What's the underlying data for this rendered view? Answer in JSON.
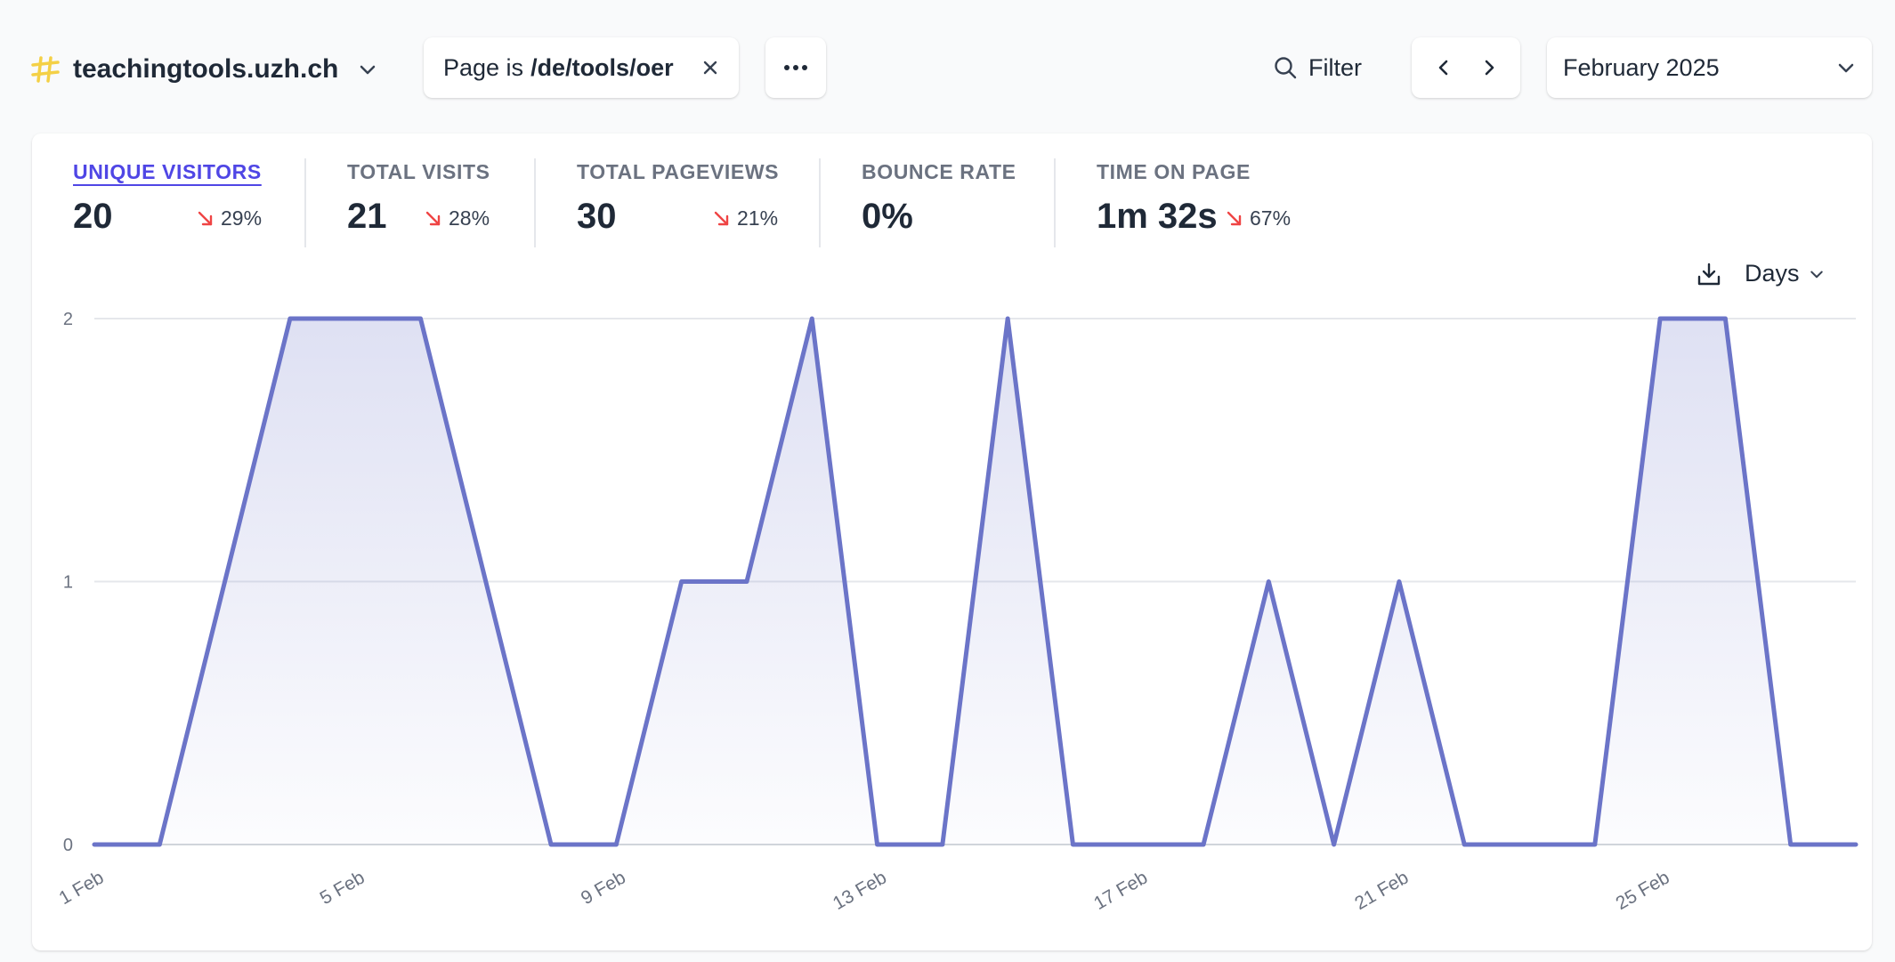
{
  "site": {
    "name": "teachingtools.uzh.ch"
  },
  "filter": {
    "prefix": "Page is",
    "value": "/de/tools/oer"
  },
  "toolbar": {
    "more_label": "···",
    "filter_label": "Filter",
    "period_label": "February 2025"
  },
  "metrics": [
    {
      "label": "UNIQUE VISITORS",
      "value": "20",
      "change": "29%"
    },
    {
      "label": "TOTAL VISITS",
      "value": "21",
      "change": "28%"
    },
    {
      "label": "TOTAL PAGEVIEWS",
      "value": "30",
      "change": "21%"
    },
    {
      "label": "BOUNCE RATE",
      "value": "0%",
      "change": ""
    },
    {
      "label": "TIME ON PAGE",
      "value": "1m 32s",
      "change": "67%"
    }
  ],
  "interval": {
    "label": "Days"
  },
  "icons": {
    "download": "download-icon",
    "chevron": "chevron-down-icon",
    "search": "search-icon",
    "close": "close-icon",
    "prev": "chevron-left-icon",
    "next": "chevron-right-icon"
  },
  "colors": {
    "line": "#6b74c8",
    "active": "#4f46e5",
    "down": "#ef4444",
    "logo": "#f4d046"
  },
  "chart_data": {
    "type": "area",
    "x": [
      "1 Feb",
      "2 Feb",
      "3 Feb",
      "4 Feb",
      "5 Feb",
      "6 Feb",
      "7 Feb",
      "8 Feb",
      "9 Feb",
      "10 Feb",
      "11 Feb",
      "12 Feb",
      "13 Feb",
      "14 Feb",
      "15 Feb",
      "16 Feb",
      "17 Feb",
      "18 Feb",
      "19 Feb",
      "20 Feb",
      "21 Feb",
      "22 Feb",
      "23 Feb",
      "24 Feb",
      "25 Feb",
      "26 Feb",
      "27 Feb",
      "28 Feb"
    ],
    "series": [
      {
        "values": [
          0,
          0,
          1,
          2,
          2,
          2,
          1,
          0,
          0,
          1,
          1,
          2,
          0,
          0,
          2,
          0,
          0,
          0,
          1,
          0,
          1,
          0,
          0,
          0,
          2,
          2,
          0,
          0
        ]
      }
    ],
    "x_tick_labels": [
      "1 Feb",
      "5 Feb",
      "9 Feb",
      "13 Feb",
      "17 Feb",
      "21 Feb",
      "25 Feb"
    ],
    "y_ticks": [
      0,
      1,
      2
    ],
    "ylim": [
      0,
      2
    ],
    "grid": true
  }
}
